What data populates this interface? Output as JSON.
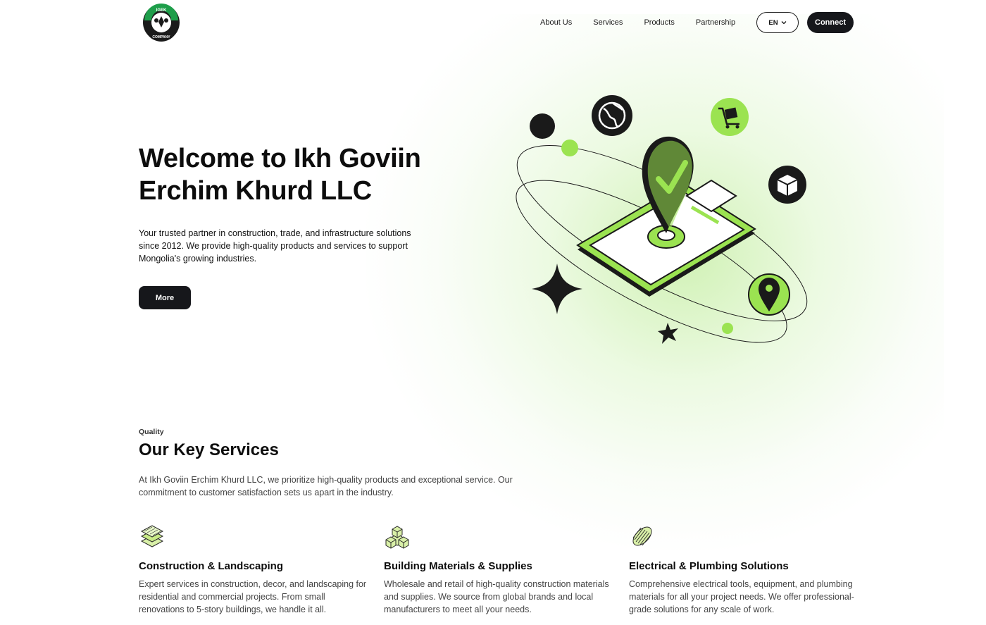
{
  "brand": {
    "logo_top_text": "IGEK",
    "logo_bottom_text": "COMPANY",
    "accent": "#9be351",
    "dark": "#16171b",
    "logo_green": "#1e9e4a"
  },
  "nav": {
    "items": [
      "About Us",
      "Services",
      "Products",
      "Partnership"
    ],
    "language": "EN",
    "connect_label": "Connect"
  },
  "hero": {
    "title": "Welcome to Ikh Goviin Erchim Khurd LLC",
    "text": "Your trusted partner in construction, trade, and infrastructure solutions since 2012. We provide high-quality products and services to support Mongolia's growing industries.",
    "button_label": "More",
    "illustration_icons": [
      "globe-icon",
      "cart-icon",
      "box-icon",
      "location-pin-icon",
      "checkmark-pin-icon",
      "clipboard-icon",
      "sparkle-icon"
    ]
  },
  "services": {
    "eyebrow": "Quality",
    "title": "Our Key Services",
    "description": "At Ikh Goviin Erchim Khurd LLC, we prioritize high-quality products and exceptional service. Our commitment to customer satisfaction sets us apart in the industry.",
    "cards": [
      {
        "icon": "layers-icon",
        "title": "Construction & Landscaping",
        "text": "Expert services in construction, decor, and landscaping for residential and commercial projects. From small renovations to 5-story buildings, we handle it all."
      },
      {
        "icon": "cubes-icon",
        "title": "Building Materials & Supplies",
        "text": "Wholesale and retail of high-quality construction materials and supplies. We source from global brands and local manufacturers to meet all your needs."
      },
      {
        "icon": "coil-icon",
        "title": "Electrical & Plumbing Solutions",
        "text": "Comprehensive electrical tools, equipment, and plumbing materials for all your project needs. We offer professional-grade solutions for any scale of work."
      }
    ]
  }
}
